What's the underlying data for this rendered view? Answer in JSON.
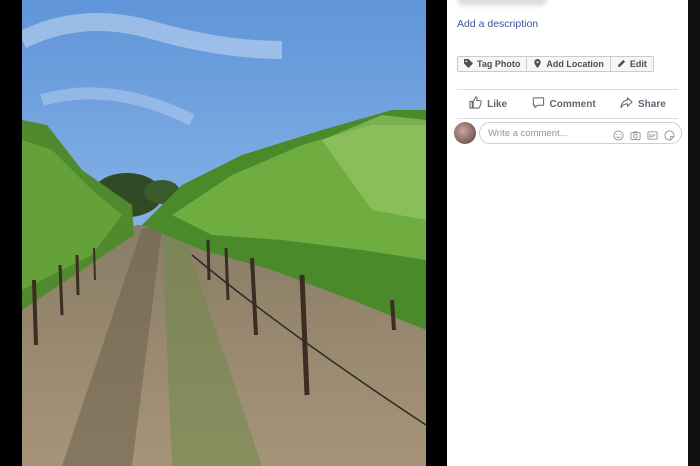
{
  "photo_panel": {
    "description_link": "Add a description",
    "chips": [
      {
        "label": "Tag Photo",
        "icon": "tag-icon"
      },
      {
        "label": "Add Location",
        "icon": "location-pin-icon"
      },
      {
        "label": "Edit",
        "icon": "pencil-icon"
      }
    ],
    "actions": [
      {
        "label": "Like",
        "icon": "thumbs-up-icon"
      },
      {
        "label": "Comment",
        "icon": "speech-bubble-icon"
      },
      {
        "label": "Share",
        "icon": "share-arrow-icon"
      }
    ],
    "comment": {
      "placeholder": "Write a comment...",
      "icons": [
        "emoji-icon",
        "camera-icon",
        "gif-icon",
        "sticker-icon"
      ]
    }
  },
  "colors": {
    "link": "#385898",
    "secondary_text": "#606770",
    "divider": "#dadde1"
  }
}
